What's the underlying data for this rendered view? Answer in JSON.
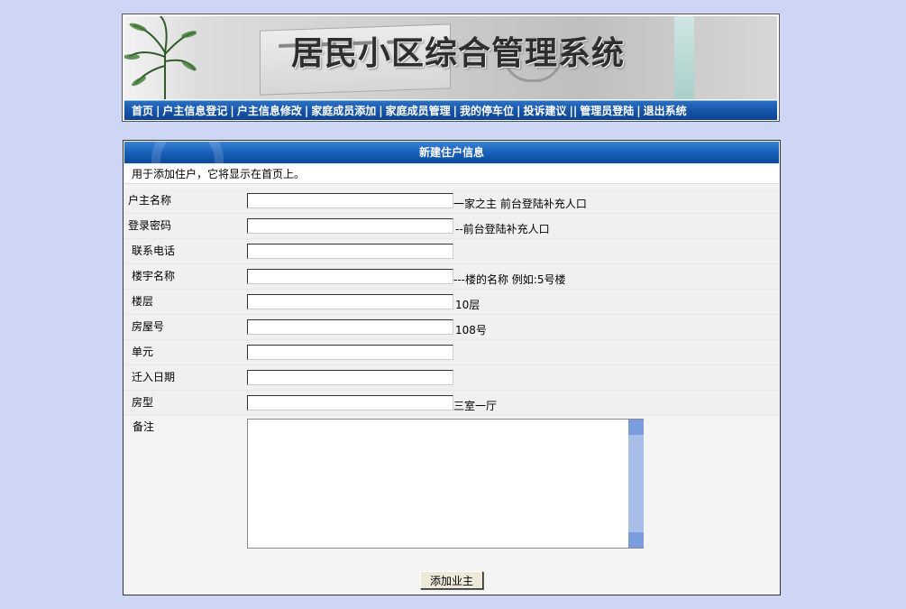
{
  "header": {
    "title": "居民小区综合管理系统",
    "nav": [
      {
        "label": "首页"
      },
      {
        "label": "户主信息登记"
      },
      {
        "label": "户主信息修改"
      },
      {
        "label": "家庭成员添加"
      },
      {
        "label": "家庭成员管理"
      },
      {
        "label": "我的停车位"
      },
      {
        "label": "投诉建议"
      },
      {
        "label": "管理员登陆"
      },
      {
        "label": "退出系统"
      }
    ]
  },
  "form": {
    "title": "新建住户信息",
    "description": "用于添加住户，它将显示在首页上。",
    "fields": [
      {
        "label": "户主名称",
        "value": "",
        "hint": "一家之主  前台登陆补充人口"
      },
      {
        "label": "登录密码",
        "value": "",
        "hint": " --前台登陆补充人口"
      },
      {
        "label": "联系电话",
        "value": "",
        "hint": ""
      },
      {
        "label": "楼宇名称",
        "value": "",
        "hint": "---楼的名称 例如:5号楼"
      },
      {
        "label": "楼层",
        "value": "",
        "hint": " 10层"
      },
      {
        "label": "房屋号",
        "value": "",
        "hint": "108号"
      },
      {
        "label": "单元",
        "value": "",
        "hint": ""
      },
      {
        "label": "迁入日期",
        "value": "",
        "hint": ""
      },
      {
        "label": "房型",
        "value": "",
        "hint": "三室一厅"
      }
    ],
    "remark_label": "备注",
    "remark_value": "",
    "submit_label": "添加业主"
  },
  "colors": {
    "page_background": "#cdd6f4",
    "nav_blue": "#1553a6",
    "header_blue": "#1860b8",
    "scrollbar": "#a9bde9"
  }
}
